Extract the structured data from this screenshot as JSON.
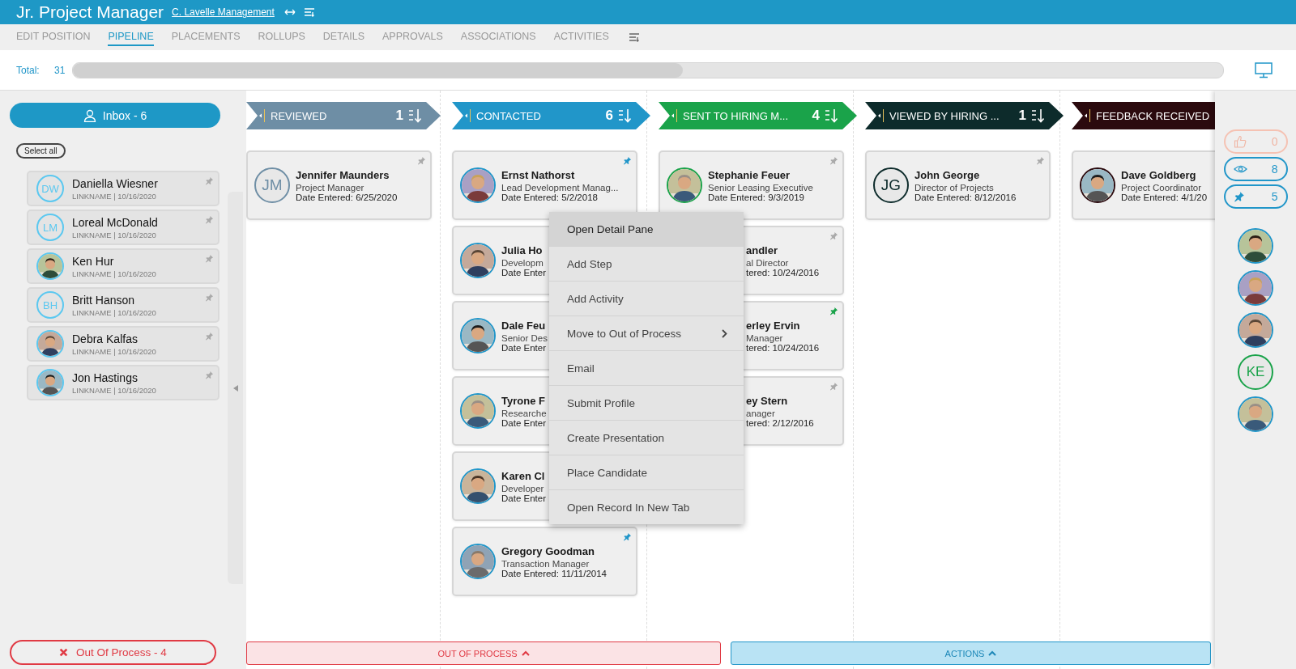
{
  "header": {
    "title": "Jr. Project Manager",
    "company_link": "C. Lavelle Management"
  },
  "tabs": [
    {
      "label": "EDIT POSITION",
      "selected": false
    },
    {
      "label": "PIPELINE",
      "selected": true
    },
    {
      "label": "PLACEMENTS",
      "selected": false
    },
    {
      "label": "ROLLUPS",
      "selected": false
    },
    {
      "label": "DETAILS",
      "selected": false
    },
    {
      "label": "APPROVALS",
      "selected": false
    },
    {
      "label": "ASSOCIATIONS",
      "selected": false
    },
    {
      "label": "ACTIVITIES",
      "selected": false
    }
  ],
  "total": {
    "label": "Total:",
    "count": "31",
    "level": 0.53
  },
  "inbox": {
    "button": "Inbox - 6",
    "select_all": "Select all",
    "items": [
      {
        "name": "Daniella Wiesner",
        "meta": "LINKNAME | 10/16/2020",
        "avatar": {
          "kind": "initials",
          "text": "DW"
        },
        "pinned": false
      },
      {
        "name": "Loreal McDonald",
        "meta": "LINKNAME | 10/16/2020",
        "avatar": {
          "kind": "initials",
          "text": "LM"
        },
        "pinned": false
      },
      {
        "name": "Ken Hur",
        "meta": "LINKNAME | 10/16/2020",
        "avatar": {
          "kind": "picture"
        },
        "pinned": false
      },
      {
        "name": "Britt Hanson",
        "meta": "LINKNAME | 10/16/2020",
        "avatar": {
          "kind": "initials",
          "text": "BH"
        },
        "pinned": false
      },
      {
        "name": "Debra Kalfas",
        "meta": "LINKNAME | 10/16/2020",
        "avatar": {
          "kind": "picture"
        },
        "pinned": false
      },
      {
        "name": "Jon Hastings",
        "meta": "LINKNAME | 10/16/2020",
        "avatar": {
          "kind": "picture"
        },
        "pinned": false
      }
    ]
  },
  "out_of_process_button": "Out Of Process - 4",
  "columns": [
    {
      "title": "REVIEWED",
      "count": "1",
      "color": "#6e8ea5",
      "cards": [
        {
          "kind": "full",
          "name": "Jennifer Maunders",
          "title": "Project Manager",
          "date": "Date Entered: 6/25/2020",
          "avatar": {
            "kind": "initials",
            "text": "JM"
          },
          "pinned": false
        }
      ]
    },
    {
      "title": "CONTACTED",
      "count": "6",
      "color": "#2196c9",
      "cards": [
        {
          "kind": "full",
          "name": "Ernst Nathorst",
          "title": "Lead Development Manag...",
          "date": "Date Entered: 5/2/2018",
          "avatar": {
            "kind": "picture"
          },
          "pinned": true
        },
        {
          "kind": "full",
          "name": "Julia Ho",
          "title": "Developm",
          "date": "Date Enter",
          "avatar": {
            "kind": "picture"
          }
        },
        {
          "kind": "full",
          "name": "Dale Feu",
          "title": "Senior Des",
          "date": "Date Enter",
          "avatar": {
            "kind": "picture"
          }
        },
        {
          "kind": "full",
          "name": "Tyrone F",
          "title": "Researche",
          "date": "Date Enter",
          "avatar": {
            "kind": "picture"
          }
        },
        {
          "kind": "full",
          "name": "Karen Cl",
          "title": "Developer",
          "date": "Date Enter",
          "avatar": {
            "kind": "picture"
          }
        },
        {
          "kind": "full",
          "name": "Gregory Goodman",
          "title": "Transaction Manager",
          "date": "Date Entered: 11/11/2014",
          "avatar": {
            "kind": "picture"
          },
          "pinned": true
        }
      ]
    },
    {
      "title": "SENT TO HIRING M...",
      "count": "4",
      "color": "#1aa34a",
      "cards": [
        {
          "kind": "full",
          "name": "Stephanie Feuer",
          "title": "Senior Leasing Executive",
          "date": "Date Entered: 9/3/2019",
          "avatar": {
            "kind": "picture"
          },
          "pinned": false
        },
        {
          "kind": "covered",
          "name": "andler",
          "title": "al Director",
          "date": "tered: 10/24/2016",
          "pinned": false
        },
        {
          "kind": "covered",
          "name": "erley Ervin",
          "title": "Manager",
          "date": "tered: 10/24/2016",
          "pinned": true
        },
        {
          "kind": "covered",
          "name": "ey Stern",
          "title": "anager",
          "date": "tered: 2/12/2016",
          "pinned": false
        }
      ]
    },
    {
      "title": "VIEWED BY HIRING ...",
      "count": "1",
      "color": "#0d2b2b",
      "cards": [
        {
          "kind": "full",
          "name": "John George",
          "title": "Director of Projects",
          "date": "Date Entered: 8/12/2016",
          "avatar": {
            "kind": "initials",
            "text": "JG"
          },
          "pinned": false
        }
      ]
    },
    {
      "title": "FEEDBACK RECEIVED",
      "color": "#2b0a0e",
      "cards": [
        {
          "kind": "full",
          "name": "Dave Goldberg",
          "title": "Project Coordinator",
          "date": "Date Entered: 4/1/20",
          "avatar": {
            "kind": "picture"
          }
        }
      ]
    }
  ],
  "context_menu": [
    {
      "label": "Open Detail Pane",
      "highlighted": true,
      "kind": "action"
    },
    {
      "label": "Add Step",
      "highlighted": false,
      "kind": "action"
    },
    {
      "label": "Add Activity",
      "highlighted": false,
      "kind": "action"
    },
    {
      "label": "Move to Out of Process",
      "highlighted": false,
      "kind": "submenu"
    },
    {
      "label": "Email",
      "highlighted": false,
      "kind": "action"
    },
    {
      "label": "Submit Profile",
      "highlighted": false,
      "kind": "action"
    },
    {
      "label": "Create Presentation",
      "highlighted": false,
      "kind": "action"
    },
    {
      "label": "Place Candidate",
      "highlighted": false,
      "kind": "action"
    },
    {
      "label": "Open Record In New Tab",
      "highlighted": false,
      "kind": "action"
    }
  ],
  "bottom_bars": [
    {
      "label": "OUT OF PROCESS",
      "kind": "danger"
    },
    {
      "label": "ACTIONS",
      "kind": "info"
    }
  ],
  "right_panel": {
    "counters": [
      {
        "kind": "like",
        "count": "0",
        "disabled": true
      },
      {
        "kind": "views",
        "count": "8",
        "disabled": false
      },
      {
        "kind": "pinned",
        "count": "5",
        "disabled": false
      }
    ],
    "avatars": [
      {
        "kind": "picture",
        "color": "#2196c9"
      },
      {
        "kind": "picture",
        "color": "#2196c9"
      },
      {
        "kind": "picture",
        "color": "#2196c9"
      },
      {
        "kind": "initials",
        "text": "KE",
        "color": "#1aa34a"
      },
      {
        "kind": "picture",
        "color": "#2196c9"
      }
    ]
  }
}
